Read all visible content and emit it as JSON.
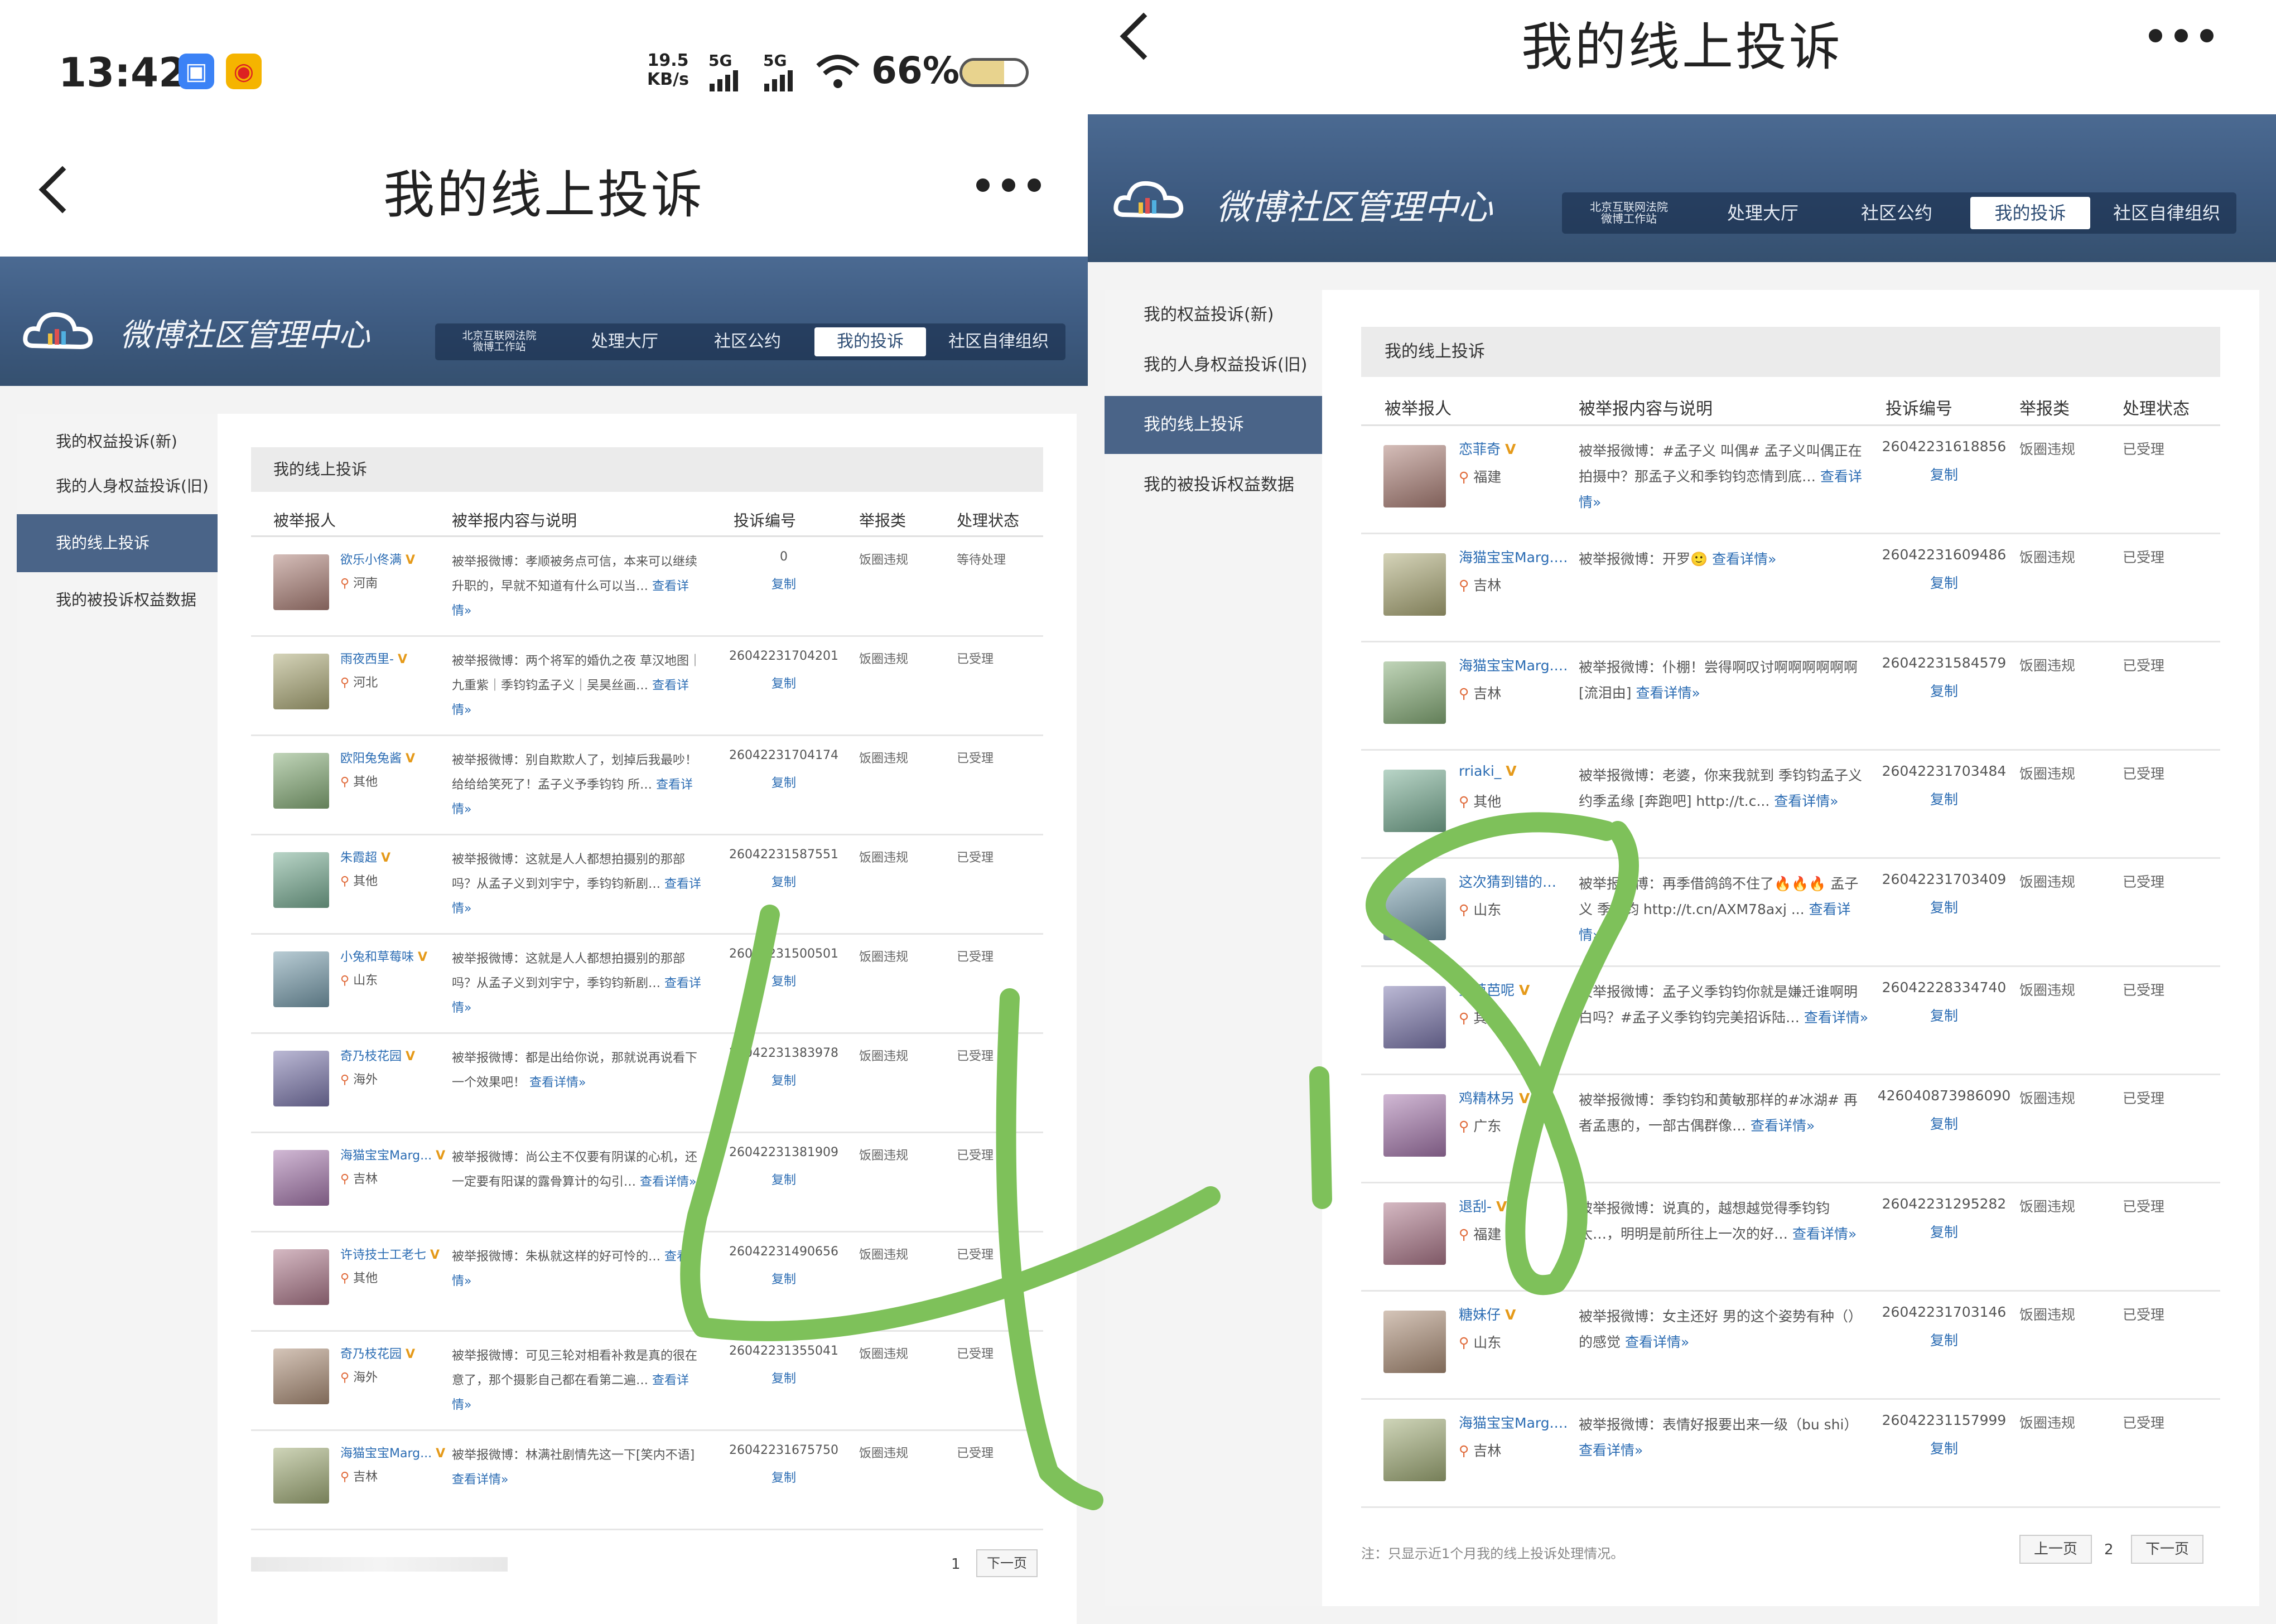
{
  "status_bar": {
    "time": "13:42",
    "speed": "19.5",
    "speed_unit": "KB/s",
    "net1": "5G",
    "net2": "5G",
    "battery_pct": "66%",
    "battery_level": 0.66
  },
  "app": {
    "title": "我的线上投诉"
  },
  "portal": {
    "logo_text": "微博社区管理中心",
    "tabs": [
      "北京互联网法院\n微博工作站",
      "处理大厅",
      "社区公约",
      "我的投诉",
      "社区自律组织"
    ],
    "active_tab_index": 3
  },
  "sidebar": {
    "items": [
      "我的权益投诉(新)",
      "我的人身权益投诉(旧)",
      "我的线上投诉",
      "我的被投诉权益数据"
    ],
    "active_index": 2
  },
  "table": {
    "title": "我的线上投诉",
    "headers": [
      "被举报人",
      "被举报内容与说明",
      "投诉编号",
      "举报类",
      "处理状态"
    ],
    "copy_label": "复制",
    "more_label": "查看详情»"
  },
  "left_rows": [
    {
      "user": "欲乐小佟满",
      "region": "河南",
      "desc": "被举报微博：孝顺被务点可信，本来可以继续升职的，早就不知道有什么可以当…",
      "id": "0",
      "type": "饭圈违规",
      "status": "等待处理"
    },
    {
      "user": "雨夜西里-",
      "region": "河北",
      "desc": "被举报微博：两个将军的婚仇之夜 草汉地图｜九重紫｜季钧钧孟子义｜吴昊丝画…",
      "id": "26042231704201",
      "type": "饭圈违规",
      "status": "已受理"
    },
    {
      "user": "欧阳兔兔酱",
      "region": "其他",
      "desc": "被举报微博：别自欺欺人了，划掉后我最吵！给给给笑死了！孟子义予季钧钧 所…",
      "id": "26042231704174",
      "type": "饭圈违规",
      "status": "已受理"
    },
    {
      "user": "朱霞超",
      "region": "其他",
      "desc": "被举报微博：这就是人人都想拍摄别的那部吗？从孟子义到刘宇宁，季钧钧新剧…",
      "id": "26042231587551",
      "type": "饭圈违规",
      "status": "已受理"
    },
    {
      "user": "小兔和草莓味",
      "region": "山东",
      "desc": "被举报微博：这就是人人都想拍摄别的那部吗？从孟子义到刘宇宁，季钧钧新剧…",
      "id": "26042231500501",
      "type": "饭圈违规",
      "status": "已受理"
    },
    {
      "user": "奇乃枝花园",
      "region": "海外",
      "desc": "被举报微博：都是出给你说，那就说再说看下一个效果吧！",
      "id": "26042231383978",
      "type": "饭圈违规",
      "status": "已受理"
    },
    {
      "user": "海猫宝宝Marg...",
      "region": "吉林",
      "desc": "被举报微博：尚公主不仅要有阴谋的心机，还一定要有阳谋的露骨算计的勾引…",
      "id": "26042231381909",
      "type": "饭圈违规",
      "status": "已受理"
    },
    {
      "user": "许诗技士工老七",
      "region": "其他",
      "desc": "被举报微博：朱枞就这样的好可怜的…",
      "id": "26042231490656",
      "type": "饭圈违规",
      "status": "已受理"
    },
    {
      "user": "奇乃枝花园",
      "region": "海外",
      "desc": "被举报微博：可见三轮对相看补救是真的很在意了，那个摄影自己都在看第二遍…",
      "id": "26042231355041",
      "type": "饭圈违规",
      "status": "已受理"
    },
    {
      "user": "海猫宝宝Marg...",
      "region": "吉林",
      "desc": "被举报微博：林满社剧情先这一下[笑内不语]",
      "id": "26042231675750",
      "type": "饭圈违规",
      "status": "已受理"
    }
  ],
  "left_pagination": {
    "page": "1",
    "next": "下一页"
  },
  "right_rows": [
    {
      "user": "恋菲奇",
      "region": "福建",
      "desc": "被举报微博：#孟子义 叫偶# 孟子义叫偶正在拍摄中？那孟子义和季钧钧恋情到底…",
      "id": "26042231618856",
      "type": "饭圈违规",
      "status": "已受理"
    },
    {
      "user": "海猫宝宝Marg...",
      "region": "吉林",
      "desc": "被举报微博：开罗🙂",
      "id": "26042231609486",
      "type": "饭圈违规",
      "status": "已受理"
    },
    {
      "user": "海猫宝宝Marg...",
      "region": "吉林",
      "desc": "被举报微博：仆棚！尝得啊叹讨啊啊啊啊啊啊[流泪由]",
      "id": "26042231584579",
      "type": "饭圈违规",
      "status": "已受理"
    },
    {
      "user": "rriaki_",
      "region": "其他",
      "desc": "被举报微博：老婆，你来我就到 季钧钧孟子义 约季孟缘 [奔跑吧] http://t.c...",
      "id": "26042231703484",
      "type": "饭圈违规",
      "status": "已受理"
    },
    {
      "user": "这次猜到错的了_",
      "region": "山东",
      "desc": "被举报微博：再季借鸽鸽不住了🔥🔥🔥 孟子义 季钧钧 http://t.cn/AXM78axj ...",
      "id": "26042231703409",
      "type": "饭圈违规",
      "status": "已受理"
    },
    {
      "user": "宝芭芭呢",
      "region": "其他",
      "desc": "被举报微博：孟子义季钧钧你就是嫌迁谁啊明白吗？#孟子义季钧钧完美招诉陆…",
      "id": "26042228334740",
      "type": "饭圈违规",
      "status": "已受理"
    },
    {
      "user": "鸡精林另",
      "region": "广东",
      "desc": "被举报微博：季钧钧和黄敏那样的#冰湖# 再者孟惠的，一部古偶群像…",
      "id": "426040873986090",
      "type": "饭圈违规",
      "status": "已受理"
    },
    {
      "user": "退刮-",
      "region": "福建",
      "desc": "被举报微博：说真的，越想越觉得季钧钧太…，明明是前所往上一次的好…",
      "id": "26042231295282",
      "type": "饭圈违规",
      "status": "已受理"
    },
    {
      "user": "糖妹仔",
      "region": "山东",
      "desc": "被举报微博：女主还好 男的这个姿势有种（）的感觉",
      "id": "26042231703146",
      "type": "饭圈违规",
      "status": "已受理"
    },
    {
      "user": "海猫宝宝Marg...",
      "region": "吉林",
      "desc": "被举报微博：表情好报要出来一级（bu shi）",
      "id": "26042231157999",
      "type": "饭圈违规",
      "status": "已受理"
    }
  ],
  "right_footer": {
    "note": "注：只显示近1个月我的线上投诉处理情况。",
    "prev": "上一页",
    "page": "2",
    "next": "下一页"
  },
  "overlay": {
    "handwriting": "4.8",
    "color": "#7ec15a"
  },
  "colors": {
    "nav_bg": "#3d5a80",
    "sidebar_active": "#4a6488",
    "link": "#2b6cb3",
    "vip": "#e59a1a"
  }
}
